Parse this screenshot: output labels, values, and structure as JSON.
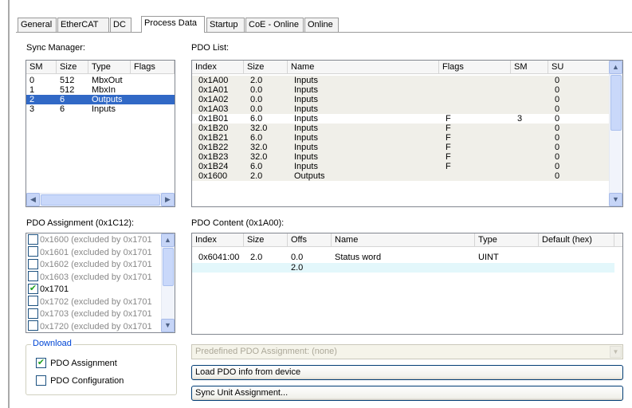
{
  "tabs": [
    {
      "label": "General",
      "active": false
    },
    {
      "label": "EtherCAT",
      "active": false
    },
    {
      "label": "DC",
      "active": false
    },
    {
      "label": "Process Data",
      "active": true
    },
    {
      "label": "Startup",
      "active": false
    },
    {
      "label": "CoE - Online",
      "active": false
    },
    {
      "label": "Online",
      "active": false
    }
  ],
  "sync_manager": {
    "caption": "Sync Manager:",
    "columns": [
      "SM",
      "Size",
      "Type",
      "Flags"
    ],
    "rows": [
      {
        "sm": "0",
        "size": "512",
        "type": "MbxOut",
        "flags": "",
        "selected": false
      },
      {
        "sm": "1",
        "size": "512",
        "type": "MbxIn",
        "flags": "",
        "selected": false
      },
      {
        "sm": "2",
        "size": "6",
        "type": "Outputs",
        "flags": "",
        "selected": true
      },
      {
        "sm": "3",
        "size": "6",
        "type": "Inputs",
        "flags": "",
        "selected": false
      }
    ]
  },
  "pdo_list": {
    "caption": "PDO List:",
    "columns": [
      "Index",
      "Size",
      "Name",
      "Flags",
      "SM",
      "SU"
    ],
    "rows": [
      {
        "index": "0x1A00",
        "size": "2.0",
        "name": "Inputs",
        "flags": "",
        "sm": "",
        "su": "0",
        "shade": "grey"
      },
      {
        "index": "0x1A01",
        "size": "0.0",
        "name": "Inputs",
        "flags": "",
        "sm": "",
        "su": "0",
        "shade": "grey"
      },
      {
        "index": "0x1A02",
        "size": "0.0",
        "name": "Inputs",
        "flags": "",
        "sm": "",
        "su": "0",
        "shade": "grey"
      },
      {
        "index": "0x1A03",
        "size": "0.0",
        "name": "Inputs",
        "flags": "",
        "sm": "",
        "su": "0",
        "shade": "grey"
      },
      {
        "index": "0x1B01",
        "size": "6.0",
        "name": "Inputs",
        "flags": "F",
        "sm": "3",
        "su": "0",
        "shade": "white"
      },
      {
        "index": "0x1B20",
        "size": "32.0",
        "name": "Inputs",
        "flags": "F",
        "sm": "",
        "su": "0",
        "shade": "grey"
      },
      {
        "index": "0x1B21",
        "size": "6.0",
        "name": "Inputs",
        "flags": "F",
        "sm": "",
        "su": "0",
        "shade": "grey"
      },
      {
        "index": "0x1B22",
        "size": "32.0",
        "name": "Inputs",
        "flags": "F",
        "sm": "",
        "su": "0",
        "shade": "grey"
      },
      {
        "index": "0x1B23",
        "size": "32.0",
        "name": "Inputs",
        "flags": "F",
        "sm": "",
        "su": "0",
        "shade": "grey"
      },
      {
        "index": "0x1B24",
        "size": "6.0",
        "name": "Inputs",
        "flags": "F",
        "sm": "",
        "su": "0",
        "shade": "grey"
      },
      {
        "index": "0x1600",
        "size": "2.0",
        "name": "Outputs",
        "flags": "",
        "sm": "",
        "su": "0",
        "shade": "grey"
      }
    ]
  },
  "pdo_assignment": {
    "caption": "PDO Assignment (0x1C12):",
    "items": [
      {
        "label": "0x1600 (excluded by 0x1701",
        "checked": false,
        "muted": true
      },
      {
        "label": "0x1601 (excluded by 0x1701",
        "checked": false,
        "muted": true
      },
      {
        "label": "0x1602 (excluded by 0x1701",
        "checked": false,
        "muted": true
      },
      {
        "label": "0x1603 (excluded by 0x1701",
        "checked": false,
        "muted": true
      },
      {
        "label": "0x1701",
        "checked": true,
        "muted": false
      },
      {
        "label": "0x1702 (excluded by 0x1701",
        "checked": false,
        "muted": true
      },
      {
        "label": "0x1703 (excluded by 0x1701",
        "checked": false,
        "muted": true
      },
      {
        "label": "0x1720 (excluded by 0x1701",
        "checked": false,
        "muted": true
      }
    ]
  },
  "pdo_content": {
    "caption": "PDO Content (0x1A00):",
    "columns": [
      "Index",
      "Size",
      "Offs",
      "Name",
      "Type",
      "Default (hex)"
    ],
    "rows": [
      {
        "index": "0x6041:00",
        "size": "2.0",
        "offs": "0.0",
        "name": "Status word",
        "type": "UINT",
        "default": ""
      },
      {
        "index": "",
        "size": "",
        "offs": "2.0",
        "name": "",
        "type": "",
        "default": ""
      }
    ]
  },
  "download": {
    "legend": "Download",
    "pdo_assignment_label": "PDO Assignment",
    "pdo_assignment_checked": true,
    "pdo_configuration_label": "PDO Configuration",
    "pdo_configuration_checked": false
  },
  "predefined": {
    "value": "Predefined PDO Assignment: (none)"
  },
  "buttons": {
    "load_pdo": "Load PDO info from device",
    "sync_unit": "Sync Unit Assignment..."
  },
  "colors": {
    "selection": "#3169c6",
    "checkmark": "#21a121",
    "group_legend": "#0046d5"
  }
}
